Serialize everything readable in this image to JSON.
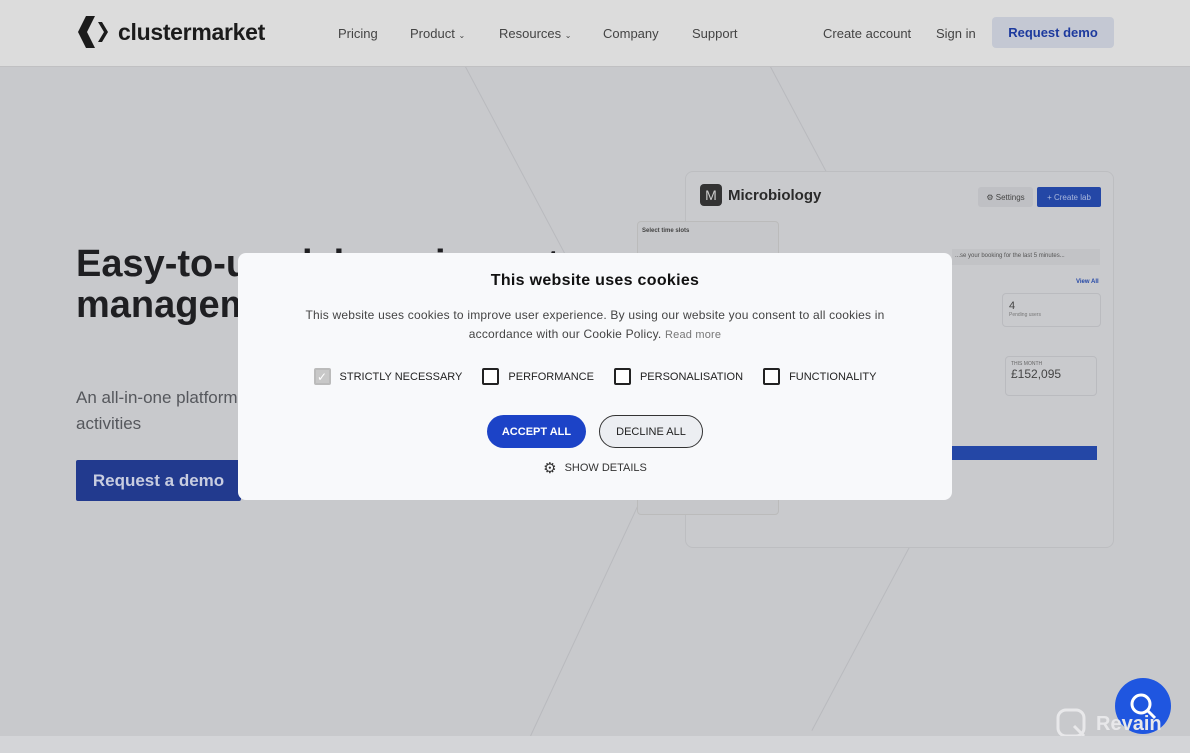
{
  "header": {
    "brand": "clustermarket",
    "nav": [
      "Pricing",
      "Product",
      "Resources",
      "Company",
      "Support"
    ],
    "create_account": "Create account",
    "sign_in": "Sign in",
    "request_demo": "Request demo"
  },
  "hero": {
    "title": "Easy-to-use lab equipment management",
    "subtitle": "An all-in-one platform for lab equipment scheduling and maintenance activities",
    "cta": "Request a demo"
  },
  "preview": {
    "icon_letter": "M",
    "title": "Microbiology",
    "settings": "⚙ Settings",
    "create_lab": "+ Create lab",
    "time_slots": "Select time slots",
    "notice": "...se your booking for the last 5 minutes...",
    "view_all": "View All",
    "pending_count": "4",
    "pending_label": "Pending users",
    "month_label": "THIS MONTH",
    "month_value": "£152,095"
  },
  "cookie": {
    "title": "This website uses cookies",
    "text": "This website uses cookies to improve user experience. By using our website you consent to all cookies in accordance with our Cookie Policy.",
    "read_more": "Read more",
    "options": [
      {
        "label": "STRICTLY NECESSARY",
        "checked": true
      },
      {
        "label": "PERFORMANCE",
        "checked": false
      },
      {
        "label": "PERSONALISATION",
        "checked": false
      },
      {
        "label": "FUNCTIONALITY",
        "checked": false
      }
    ],
    "accept": "ACCEPT ALL",
    "decline": "DECLINE ALL",
    "show_details": "SHOW DETAILS"
  },
  "watermark": "Revain",
  "colors": {
    "accent": "#1c43c7",
    "brand_button": "#223a8e",
    "chat": "#1f56e0"
  }
}
